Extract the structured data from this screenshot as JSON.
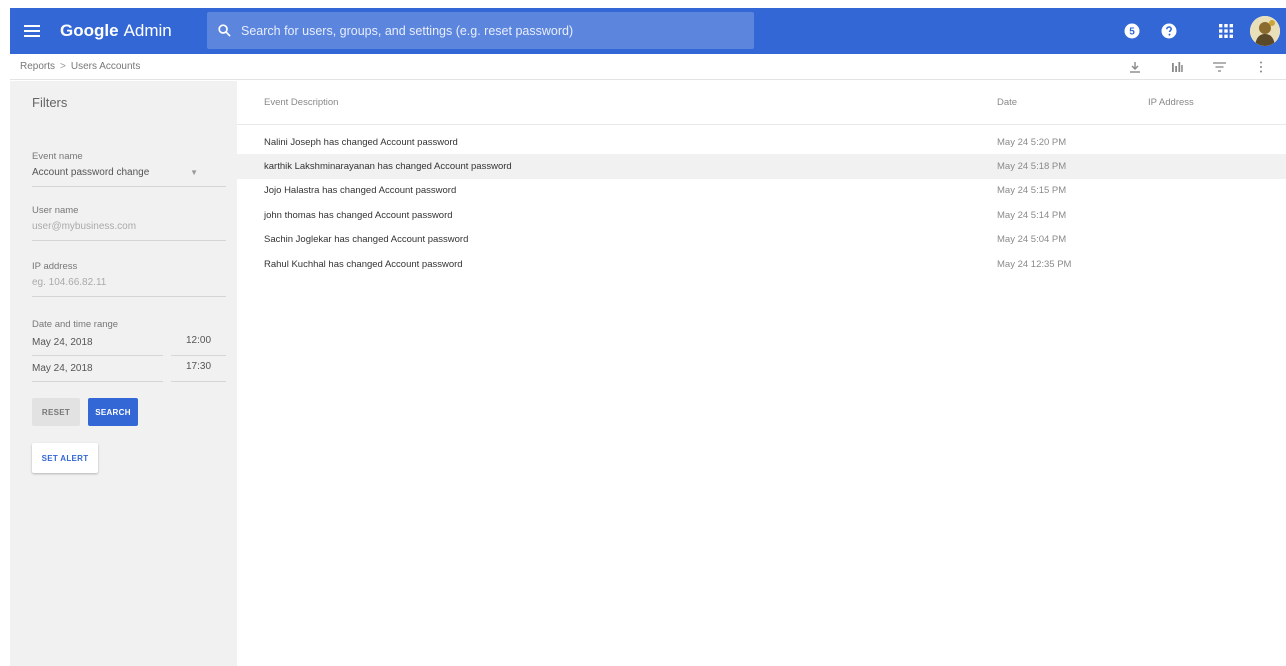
{
  "app": {
    "logo_brand": "Google",
    "logo_product": "Admin"
  },
  "search": {
    "placeholder": "Search for users, groups, and settings (e.g. reset password)"
  },
  "top_icons": {
    "notification_badge": "5"
  },
  "breadcrumb": {
    "items": [
      "Reports",
      "Users Accounts"
    ],
    "separator": ">"
  },
  "filters": {
    "title": "Filters",
    "event_name": {
      "label": "Event name",
      "value": "Account password change"
    },
    "user_name": {
      "label": "User name",
      "placeholder": "user@mybusiness.com"
    },
    "ip_address": {
      "label": "IP address",
      "placeholder": "eg. 104.66.82.11"
    },
    "date_range": {
      "label": "Date and time range",
      "start_date": "May 24, 2018",
      "start_time": "12:00",
      "end_date": "May 24, 2018",
      "end_time": "17:30"
    },
    "reset_label": "RESET",
    "search_label": "SEARCH",
    "alert_label": "SET ALERT"
  },
  "table": {
    "headers": {
      "description": "Event Description",
      "date": "Date",
      "ip": "IP Address"
    },
    "rows": [
      {
        "description": "Nalini Joseph has changed Account password",
        "date": "May 24 5:20 PM",
        "ip": ""
      },
      {
        "description": "karthik Lakshminarayanan has changed Account password",
        "date": "May 24 5:18 PM",
        "ip": ""
      },
      {
        "description": "Jojo Halastra has changed Account password",
        "date": "May 24 5:15 PM",
        "ip": ""
      },
      {
        "description": "john thomas has changed Account password",
        "date": "May 24 5:14 PM",
        "ip": ""
      },
      {
        "description": "Sachin Joglekar has changed Account password",
        "date": "May 24 5:04 PM",
        "ip": ""
      },
      {
        "description": "Rahul Kuchhal has changed Account password",
        "date": "May 24 12:35 PM",
        "ip": ""
      }
    ]
  },
  "colors": {
    "topbar": "#3367d6",
    "search_box": "#5c85de",
    "sidebar": "#f1f1f1",
    "accent": "#3367d6"
  }
}
